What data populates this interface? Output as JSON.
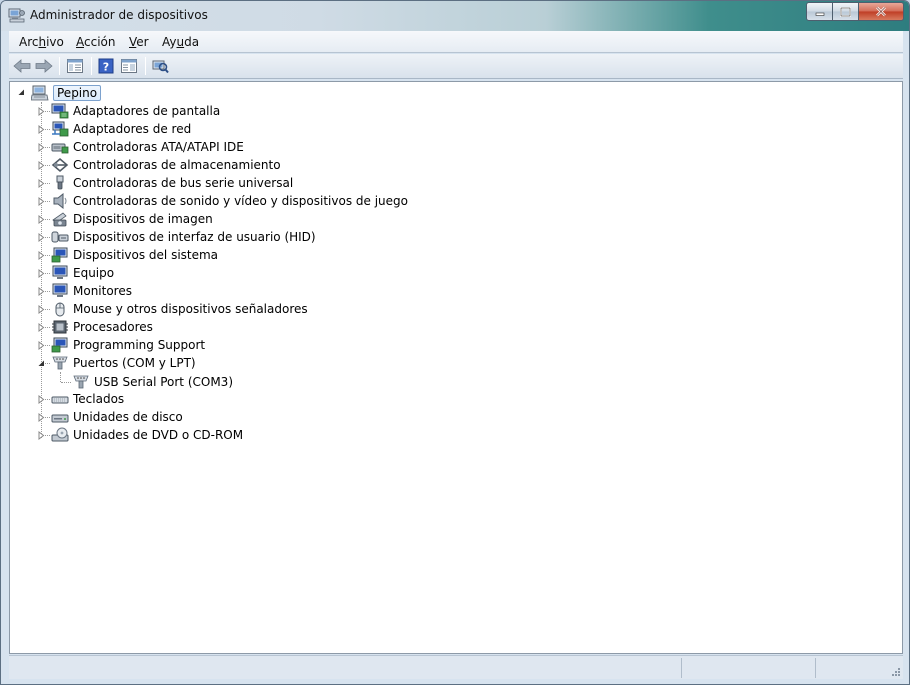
{
  "window": {
    "title": "Administrador de dispositivos",
    "controls": {
      "minimize": "minimize",
      "maximize": "maximize",
      "close": "close"
    }
  },
  "menubar": {
    "items": [
      {
        "pre": "Arc",
        "accel": "h",
        "post": "ivo"
      },
      {
        "pre": "",
        "accel": "A",
        "post": "cción"
      },
      {
        "pre": "",
        "accel": "V",
        "post": "er"
      },
      {
        "pre": "Ay",
        "accel": "u",
        "post": "da"
      }
    ]
  },
  "toolbar": {
    "buttons": [
      "back-arrow-icon",
      "forward-arrow-icon",
      "show-hide-tree-icon",
      "help-icon",
      "properties-icon",
      "scan-hardware-icon"
    ]
  },
  "tree": {
    "root": {
      "label": "Pepino",
      "icon": "computer-icon"
    },
    "nodes": [
      {
        "label": "Adaptadores de pantalla",
        "icon": "display-adapter-icon",
        "expanded": false
      },
      {
        "label": "Adaptadores de red",
        "icon": "network-adapter-icon",
        "expanded": false
      },
      {
        "label": "Controladoras ATA/ATAPI IDE",
        "icon": "ide-controller-icon",
        "expanded": false
      },
      {
        "label": "Controladoras de almacenamiento",
        "icon": "storage-controller-icon",
        "expanded": false
      },
      {
        "label": "Controladoras de bus serie universal",
        "icon": "usb-icon",
        "expanded": false
      },
      {
        "label": "Controladoras de sonido y vídeo y dispositivos de juego",
        "icon": "speaker-icon",
        "expanded": false
      },
      {
        "label": "Dispositivos de imagen",
        "icon": "camera-icon",
        "expanded": false
      },
      {
        "label": "Dispositivos de interfaz de usuario (HID)",
        "icon": "hid-icon",
        "expanded": false
      },
      {
        "label": "Dispositivos del sistema",
        "icon": "system-device-icon",
        "expanded": false
      },
      {
        "label": "Equipo",
        "icon": "monitor-icon",
        "expanded": false
      },
      {
        "label": "Monitores",
        "icon": "monitor-icon",
        "expanded": false
      },
      {
        "label": "Mouse y otros dispositivos señaladores",
        "icon": "mouse-icon",
        "expanded": false
      },
      {
        "label": "Procesadores",
        "icon": "processor-icon",
        "expanded": false
      },
      {
        "label": "Programming Support",
        "icon": "system-device-icon",
        "expanded": false
      },
      {
        "label": "Puertos (COM y LPT)",
        "icon": "port-icon",
        "expanded": true,
        "children": [
          {
            "label": "USB Serial Port (COM3)",
            "icon": "port-icon"
          }
        ]
      },
      {
        "label": "Teclados",
        "icon": "keyboard-icon",
        "expanded": false
      },
      {
        "label": "Unidades de disco",
        "icon": "disk-drive-icon",
        "expanded": false
      },
      {
        "label": "Unidades de DVD o CD-ROM",
        "icon": "dvd-drive-icon",
        "expanded": false
      }
    ]
  },
  "colors": {
    "titlebar_accent": "#2e7d7f",
    "selection_border": "#7da2ce",
    "tree_background": "#ffffff"
  }
}
